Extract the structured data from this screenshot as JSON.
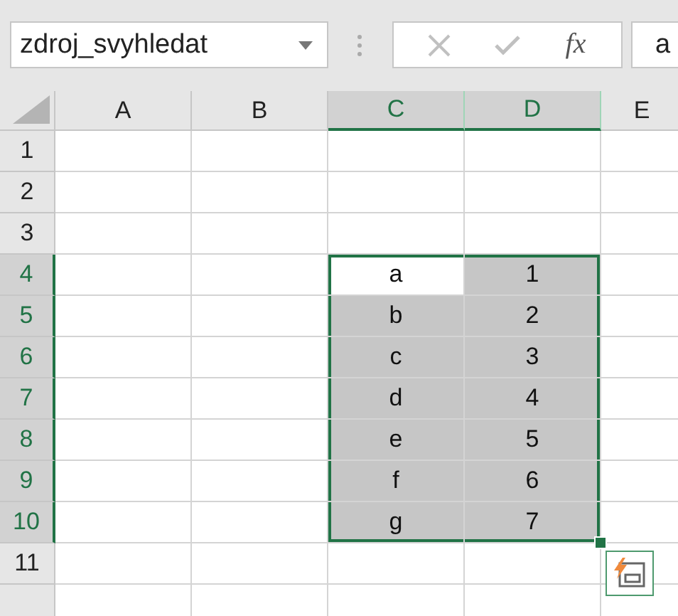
{
  "name_box": {
    "value": "zdroj_svyhledat"
  },
  "formula_bar": {
    "function_label": "fx",
    "value": "a"
  },
  "columns": [
    {
      "label": "A",
      "selected": false
    },
    {
      "label": "B",
      "selected": false
    },
    {
      "label": "C",
      "selected": true
    },
    {
      "label": "D",
      "selected": true
    },
    {
      "label": "E",
      "selected": false
    }
  ],
  "rows": [
    {
      "number": "1",
      "selected": false,
      "cells": []
    },
    {
      "number": "2",
      "selected": false,
      "cells": []
    },
    {
      "number": "3",
      "selected": false,
      "cells": []
    },
    {
      "number": "4",
      "selected": true,
      "cells": [
        {
          "text": "a",
          "selected": true,
          "active": true
        },
        {
          "text": "1",
          "selected": true,
          "active": false
        }
      ]
    },
    {
      "number": "5",
      "selected": true,
      "cells": [
        {
          "text": "b",
          "selected": true,
          "active": false
        },
        {
          "text": "2",
          "selected": true,
          "active": false
        }
      ]
    },
    {
      "number": "6",
      "selected": true,
      "cells": [
        {
          "text": "c",
          "selected": true,
          "active": false
        },
        {
          "text": "3",
          "selected": true,
          "active": false
        }
      ]
    },
    {
      "number": "7",
      "selected": true,
      "cells": [
        {
          "text": "d",
          "selected": true,
          "active": false
        },
        {
          "text": "4",
          "selected": true,
          "active": false
        }
      ]
    },
    {
      "number": "8",
      "selected": true,
      "cells": [
        {
          "text": "e",
          "selected": true,
          "active": false
        },
        {
          "text": "5",
          "selected": true,
          "active": false
        }
      ]
    },
    {
      "number": "9",
      "selected": true,
      "cells": [
        {
          "text": "f",
          "selected": true,
          "active": false
        },
        {
          "text": "6",
          "selected": true,
          "active": false
        }
      ]
    },
    {
      "number": "10",
      "selected": true,
      "cells": [
        {
          "text": "g",
          "selected": true,
          "active": false
        },
        {
          "text": "7",
          "selected": true,
          "active": false
        }
      ]
    },
    {
      "number": "11",
      "selected": false,
      "cells": []
    }
  ]
}
